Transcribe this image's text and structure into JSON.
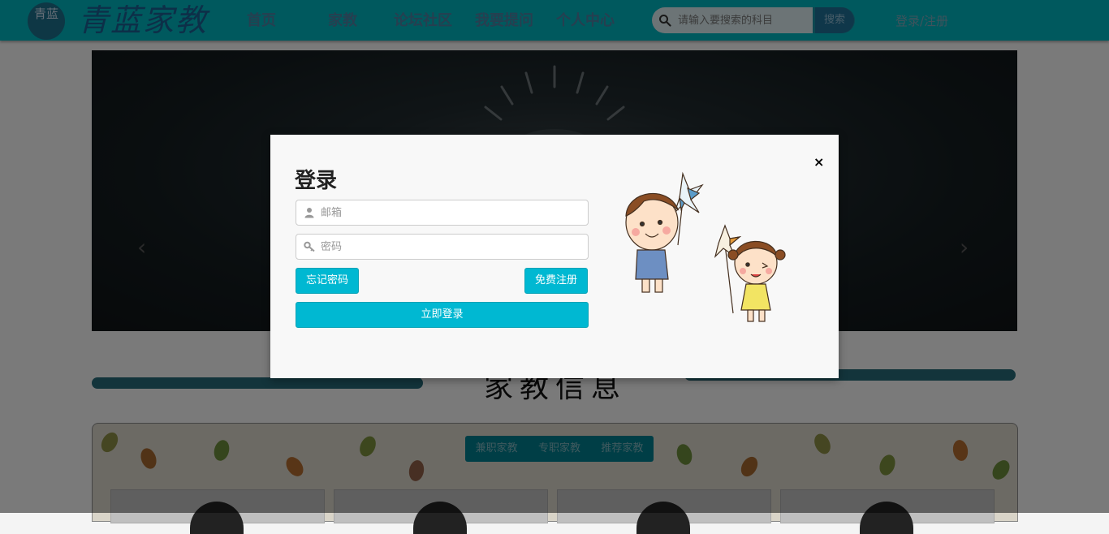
{
  "header": {
    "logo_badge": "青蓝",
    "logo_text": "青蓝家教",
    "nav": [
      "首页",
      "家教",
      "论坛社区",
      "我要提问",
      "个人中心"
    ],
    "search_placeholder": "请输入要搜索的科目",
    "search_button": "搜索",
    "login_link": "登录/注册"
  },
  "section": {
    "title": "家教信息"
  },
  "tabs": [
    "兼职家教",
    "专职家教",
    "推荐家教"
  ],
  "modal": {
    "title": "登录",
    "email_placeholder": "邮箱",
    "password_placeholder": "密码",
    "forgot_button": "忘记密码",
    "register_button": "免费注册",
    "login_button": "立即登录",
    "close_icon": "×"
  },
  "colors": {
    "header": "#00b2bd",
    "accent_button": "#00b8d2",
    "tab_bar": "#007d8d"
  },
  "icons": [
    "search-icon",
    "user-icon",
    "key-icon",
    "close-icon",
    "chevron-left-icon",
    "chevron-right-icon"
  ]
}
